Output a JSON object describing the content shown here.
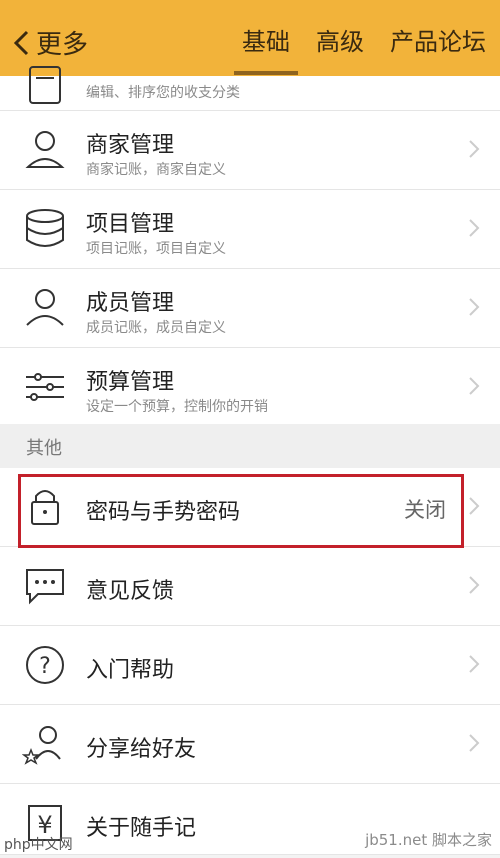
{
  "header": {
    "back_label": "更多",
    "tabs": [
      "基础",
      "高级",
      "产品论坛"
    ],
    "active_tab": "基础"
  },
  "items": [
    {
      "sub": "编辑、排序您的收支分类",
      "icon": "list-icon"
    },
    {
      "title": "商家管理",
      "sub": "商家记账，商家自定义",
      "icon": "merchant-icon"
    },
    {
      "title": "项目管理",
      "sub": "项目记账，项目自定义",
      "icon": "database-icon"
    },
    {
      "title": "成员管理",
      "sub": "成员记账，成员自定义",
      "icon": "members-icon"
    },
    {
      "title": "预算管理",
      "sub": "设定一个预算，控制你的开销",
      "icon": "sliders-icon"
    }
  ],
  "section_title": "其他",
  "other": [
    {
      "title": "密码与手势密码",
      "status": "关闭",
      "icon": "lock-icon"
    },
    {
      "title": "意见反馈",
      "icon": "chat-icon"
    },
    {
      "title": "入门帮助",
      "icon": "help-icon"
    },
    {
      "title": "分享给好友",
      "icon": "share-icon"
    },
    {
      "title": "关于随手记",
      "icon": "yen-icon"
    }
  ],
  "watermark": {
    "text": "jb51.net 脚本之家",
    "left": "php中文网"
  }
}
